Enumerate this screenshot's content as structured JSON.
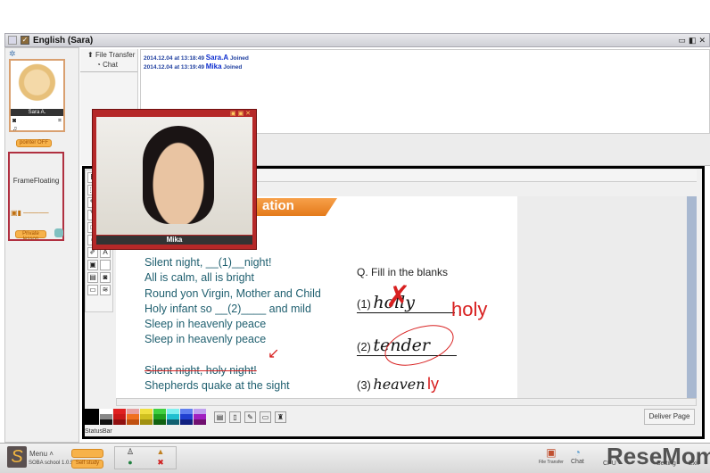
{
  "window": {
    "title": "English (Sara)"
  },
  "participants": [
    {
      "name": "Sara A."
    },
    {
      "name": "Mika"
    }
  ],
  "left_panel": {
    "pointer_button": "pointer OFF",
    "frame_label": "FrameFloating",
    "private_button": "Private lesson"
  },
  "tabs": [
    {
      "label": "File Transfer"
    },
    {
      "label": "Chat"
    }
  ],
  "log": [
    {
      "time": "2014.12.04 at 13:18:49",
      "user": "Sara.A",
      "event": "Joined"
    },
    {
      "time": "2014.12.04 at 13:19:49",
      "user": "Mika",
      "event": "Joined"
    }
  ],
  "video": {
    "name": "Mika"
  },
  "slide": {
    "banner": "ation",
    "poem": [
      "Silent night, __(1)__night!",
      "All is calm, all is bright",
      "Round yon Virgin, Mother and Child",
      "Holy infant so __(2)____ and mild",
      "Sleep in heavenly peace",
      "Sleep in heavenly peace",
      "",
      "Silent night, holy night!",
      "Shepherds quake at the sight"
    ],
    "question": "Q.   Fill in the blanks",
    "answers": [
      {
        "num": "(1)",
        "written": "holly",
        "correction": "holy"
      },
      {
        "num": "(2)",
        "written": "tender",
        "correction": ""
      },
      {
        "num": "(3)",
        "written": "heaven",
        "correction": "ly"
      }
    ]
  },
  "palette": [
    "#000000",
    "#ffffff",
    "#888888",
    "#e02020",
    "#e8a0a0",
    "#f07020",
    "#f0e040",
    "#40d040",
    "#208020",
    "#60f0f0",
    "#4060e0",
    "#c090f0",
    "#a020a0"
  ],
  "deliver_button": "Deliver Page",
  "status_bar": "StatusBar",
  "taskbar": {
    "menu": "Menu",
    "version": "SOBA school 1.0.5",
    "btn1": "Self study",
    "items": [
      "File Transfer",
      "Chat",
      "CPU",
      "Setting",
      "Exit"
    ],
    "watermark": "ReseMom"
  }
}
